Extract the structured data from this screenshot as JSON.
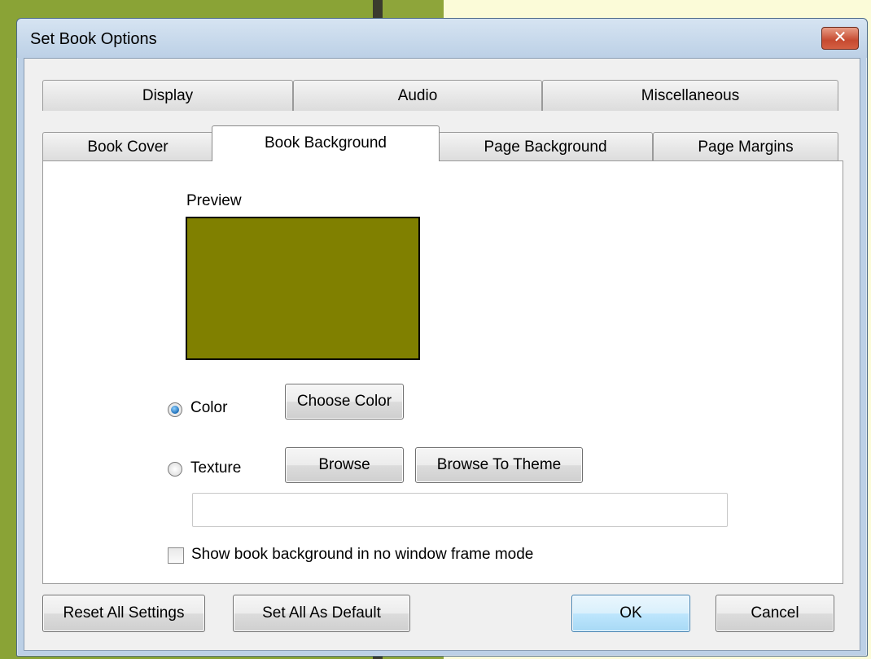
{
  "dialog": {
    "title": "Set Book Options",
    "close_symbol": "✕"
  },
  "tabs": {
    "row1": [
      "Display",
      "Audio",
      "Miscellaneous"
    ],
    "row2": [
      "Book Cover",
      "Book Background",
      "Page Background",
      "Page Margins"
    ],
    "active": "Book Background"
  },
  "book_background": {
    "preview_label": "Preview",
    "preview_color": "#808000",
    "color_option": {
      "label": "Color",
      "selected": true
    },
    "choose_color_label": "Choose Color",
    "texture_option": {
      "label": "Texture",
      "selected": false
    },
    "browse_label": "Browse",
    "browse_theme_label": "Browse To Theme",
    "texture_path": "",
    "no_frame_checkbox": {
      "label": "Show book background in no window frame mode",
      "checked": false
    }
  },
  "footer": {
    "reset_label": "Reset All Settings",
    "default_label": "Set All As Default",
    "ok_label": "OK",
    "cancel_label": "Cancel"
  }
}
